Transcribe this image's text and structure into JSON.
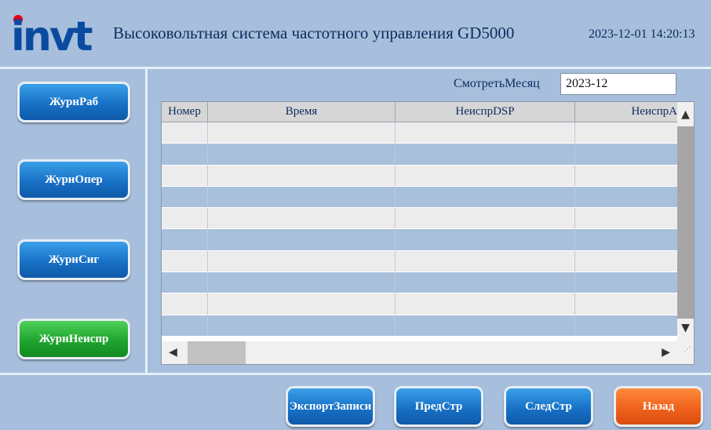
{
  "header": {
    "logo_text": "invt",
    "title": "Высоковольтная система частотного управления GD5000",
    "datetime": "2023-12-01 14:20:13"
  },
  "sidebar": {
    "items": [
      {
        "label": "ЖурнРаб"
      },
      {
        "label": "ЖурнОпер"
      },
      {
        "label": "ЖурнСиг"
      },
      {
        "label": "ЖурнНеиспр"
      }
    ]
  },
  "filter": {
    "month_label": "СмотретьМесяц",
    "month_value": "2023-12"
  },
  "table": {
    "columns": [
      "Номер",
      "Время",
      "НеиспрDSP",
      "НеиспрА"
    ],
    "rows": []
  },
  "footer": {
    "export_label": "ЭкспортЗаписи",
    "prev_label": "ПредСтр",
    "next_label": "СледСтр",
    "back_label": "Назад"
  },
  "colors": {
    "background": "#a7bfdc",
    "button_blue": "#1871c6",
    "button_green": "#1fa52d",
    "button_orange": "#f0621c"
  }
}
